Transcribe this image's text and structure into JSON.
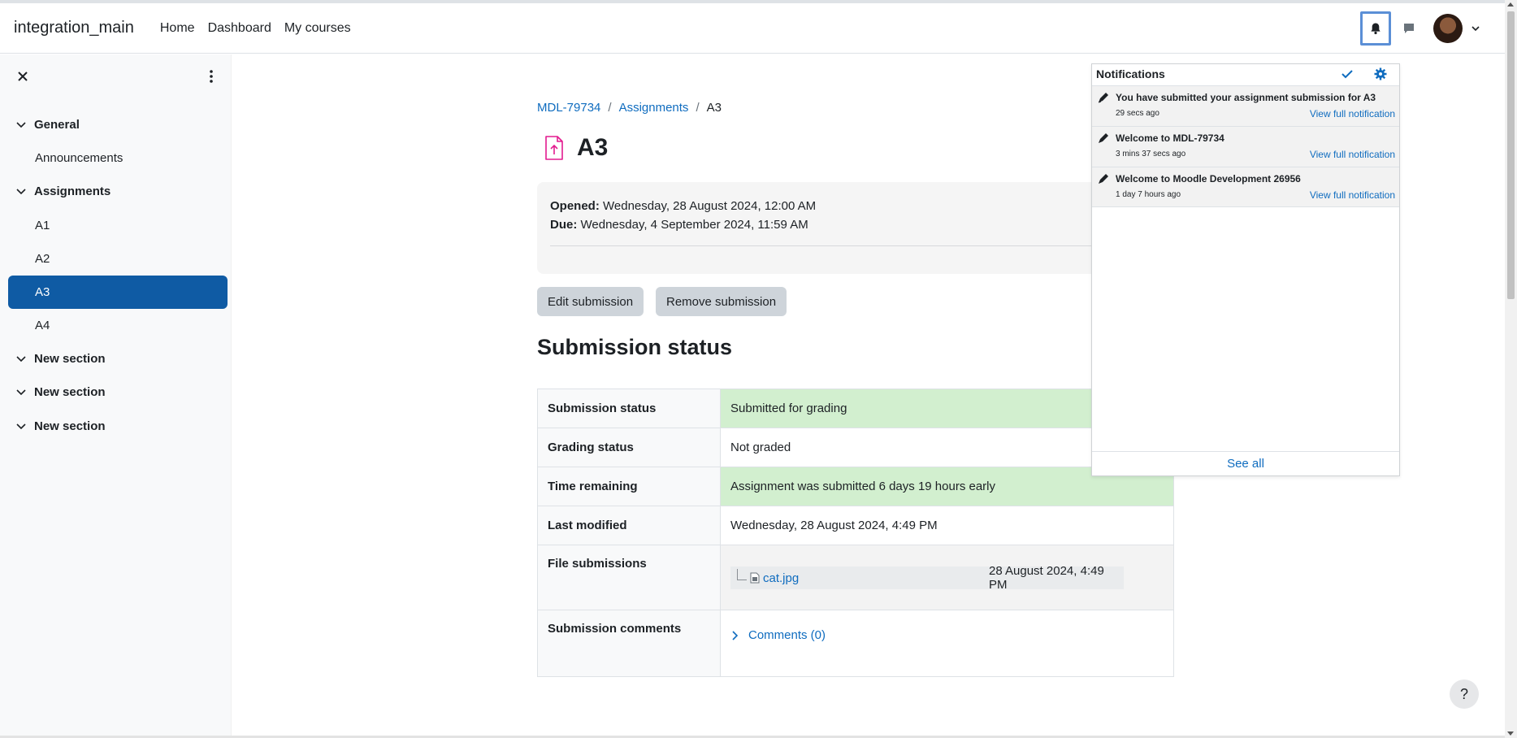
{
  "navbar": {
    "site_name": "integration_main",
    "links": [
      "Home",
      "Dashboard",
      "My courses"
    ]
  },
  "drawer": {
    "items": [
      {
        "label": "General",
        "type": "section"
      },
      {
        "label": "Announcements",
        "type": "activity"
      },
      {
        "label": "Assignments",
        "type": "section"
      },
      {
        "label": "A1",
        "type": "activity"
      },
      {
        "label": "A2",
        "type": "activity"
      },
      {
        "label": "A3",
        "type": "activity",
        "active": true
      },
      {
        "label": "A4",
        "type": "activity"
      },
      {
        "label": "New section",
        "type": "section"
      },
      {
        "label": "New section",
        "type": "section"
      },
      {
        "label": "New section",
        "type": "section"
      }
    ]
  },
  "breadcrumb": {
    "course": "MDL-79734",
    "sep1": "/",
    "module": "Assignments",
    "sep2": "/",
    "current": "A3"
  },
  "page": {
    "title": "A3",
    "opened_label": "Opened:",
    "opened_value": "Wednesday, 28 August 2024, 12:00 AM",
    "due_label": "Due:",
    "due_value": "Wednesday, 4 September 2024, 11:59 AM",
    "edit_button": "Edit submission",
    "remove_button": "Remove submission",
    "section_heading": "Submission status"
  },
  "status_table": {
    "submission_status_label": "Submission status",
    "submission_status_value": "Submitted for grading",
    "grading_status_label": "Grading status",
    "grading_status_value": "Not graded",
    "time_remaining_label": "Time remaining",
    "time_remaining_value": "Assignment was submitted 6 days 19 hours early",
    "last_modified_label": "Last modified",
    "last_modified_value": "Wednesday, 28 August 2024, 4:49 PM",
    "file_submissions_label": "File submissions",
    "file_name": "cat.jpg",
    "file_date": "28 August 2024, 4:49 PM",
    "submission_comments_label": "Submission comments",
    "comments_link": "Comments (0)"
  },
  "notifications": {
    "title": "Notifications",
    "items": [
      {
        "title": "You have submitted your assignment submission for A3",
        "time": "29 secs ago",
        "link": "View full notification"
      },
      {
        "title": "Welcome to MDL-79734",
        "time": "3 mins 37 secs ago",
        "link": "View full notification"
      },
      {
        "title": "Welcome to Moodle Development 26956",
        "time": "1 day 7 hours ago",
        "link": "View full notification"
      }
    ],
    "see_all": "See all"
  },
  "help_button": "?",
  "colors": {
    "accent": "#0f6cbf",
    "active_nav": "#0f5ba4",
    "success_bg": "#d2efcf"
  }
}
